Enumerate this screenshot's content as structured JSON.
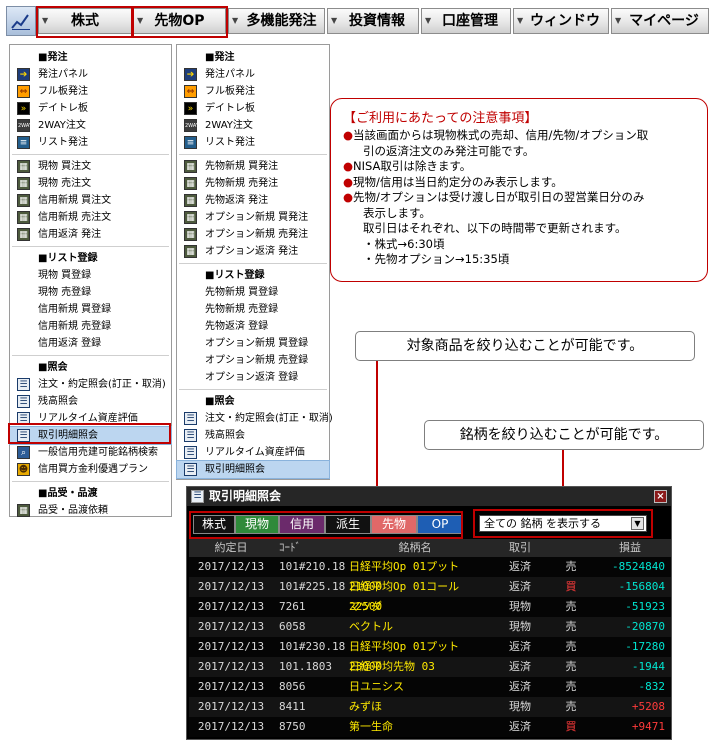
{
  "colors": {
    "accent_red": "#c00000",
    "profit_red": "#ff3b3b",
    "loss_cyan": "#00e5d0",
    "stock_green": "#00a040"
  },
  "menubar": {
    "logo_icon": "chart-logo-icon",
    "items": [
      "株式",
      "先物OP",
      "多機能発注",
      "投資情報",
      "口座管理",
      "ウィンドウ",
      "マイページ"
    ]
  },
  "menu_left": {
    "order_header": "■発注",
    "order_items": [
      "発注パネル",
      "フル板発注",
      "デイトレ板",
      "2WAY注文",
      "リスト発注"
    ],
    "trade_items": [
      "現物 買注文",
      "現物 売注文",
      "信用新規 買注文",
      "信用新規 売注文",
      "信用返済 発注"
    ],
    "list_header": "■リスト登録",
    "list_items": [
      "現物 買登録",
      "現物 売登録",
      "信用新規 買登録",
      "信用新規 売登録",
      "信用返済 登録"
    ],
    "inquiry_header": "■照会",
    "inquiry_items": [
      "注文・約定照会(訂正・取消)",
      "残高照会",
      "リアルタイム資産評価",
      "取引明細照会",
      "一般信用売建可能銘柄検索",
      "信用買方金利優遇プラン"
    ],
    "lending_header": "■品受・品渡",
    "lending_items": [
      "品受・品渡依頼"
    ]
  },
  "menu_right": {
    "order_header": "■発注",
    "order_items": [
      "発注パネル",
      "フル板発注",
      "デイトレ板",
      "2WAY注文",
      "リスト発注"
    ],
    "trade_items": [
      "先物新規 買発注",
      "先物新規 売発注",
      "先物返済 発注",
      "オプション新規 買発注",
      "オプション新規 売発注",
      "オプション返済 発注"
    ],
    "list_header": "■リスト登録",
    "list_items": [
      "先物新規 買登録",
      "先物新規 売登録",
      "先物返済 登録",
      "オプション新規 買登録",
      "オプション新規 売登録",
      "オプション返済 登録"
    ],
    "inquiry_header": "■照会",
    "inquiry_items": [
      "注文・約定照会(訂正・取消)",
      "残高照会",
      "リアルタイム資産評価",
      "取引明細照会"
    ]
  },
  "notice": {
    "title": "【ご利用にあたっての注意事項】",
    "lines": [
      "当該画面からは現物株式の売却、信用/先物/オプション取",
      "引の返済注文のみ発注可能です。",
      "NISA取引は除きます。",
      "現物/信用は当日約定分のみ表示します。",
      "先物/オプションは受け渡し日が取引日の翌営業日分のみ",
      "表示します。",
      "取引日はそれぞれ、以下の時間帯で更新されます。",
      "・株式→6:30頃",
      "・先物オプション→15:35頃"
    ]
  },
  "callouts": {
    "filter_products": "対象商品を絞り込むことが可能です。",
    "filter_symbols": "銘柄を絞り込むことが可能です。"
  },
  "window": {
    "title": "取引明細照会",
    "filters": [
      "株式",
      "現物",
      "信用",
      "派生",
      "先物",
      "OP"
    ],
    "select_value": "全ての 銘柄 を表示する",
    "columns": [
      "約定日",
      "ｺｰﾄﾞ",
      "銘柄名",
      "取引",
      "",
      "損益"
    ],
    "rows": [
      {
        "date": "2017/12/13",
        "code": "101#210.18",
        "name": "日経平均Op 01プット21000",
        "trade": "返済",
        "side": "売",
        "pnl": "-8524840"
      },
      {
        "date": "2017/12/13",
        "code": "101#225.18",
        "name": "日経平均Op 01コール22500",
        "trade": "返済",
        "side": "買",
        "pnl": "-156804"
      },
      {
        "date": "2017/12/13",
        "code": "7261",
        "name": "マツダ",
        "trade": "現物",
        "side": "売",
        "pnl": "-51923"
      },
      {
        "date": "2017/12/13",
        "code": "6058",
        "name": "ベクトル",
        "trade": "現物",
        "side": "売",
        "pnl": "-20870"
      },
      {
        "date": "2017/12/13",
        "code": "101#230.18",
        "name": "日経平均Op 01プット23000",
        "trade": "返済",
        "side": "売",
        "pnl": "-17280"
      },
      {
        "date": "2017/12/13",
        "code": "101.1803",
        "name": "日経平均先物 03",
        "trade": "返済",
        "side": "売",
        "pnl": "-1944"
      },
      {
        "date": "2017/12/13",
        "code": "8056",
        "name": "日ユニシス",
        "trade": "返済",
        "side": "売",
        "pnl": "-832"
      },
      {
        "date": "2017/12/13",
        "code": "8411",
        "name": "みずほ",
        "trade": "現物",
        "side": "売",
        "pnl": "+5208"
      },
      {
        "date": "2017/12/13",
        "code": "8750",
        "name": "第一生命",
        "trade": "返済",
        "side": "買",
        "pnl": "+9471"
      }
    ]
  }
}
